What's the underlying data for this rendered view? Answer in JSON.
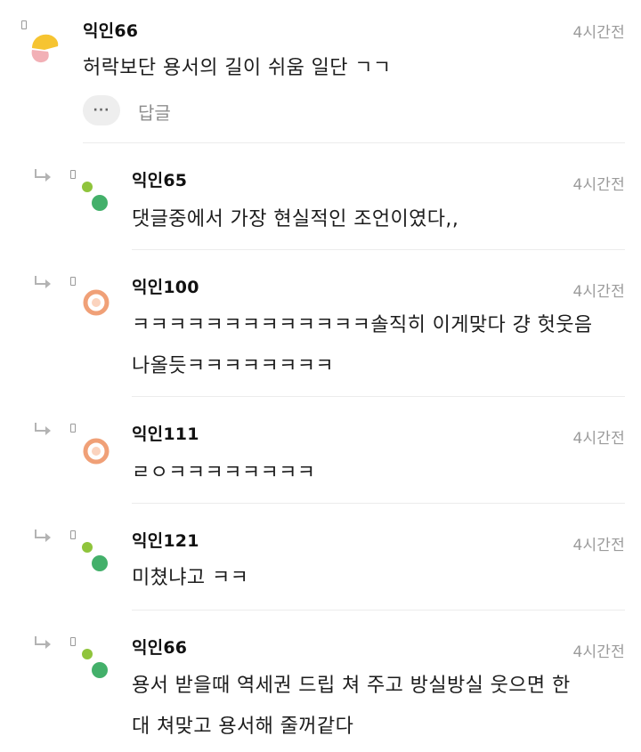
{
  "comments": [
    {
      "author": "익인66",
      "time": "4시간전",
      "text": "허락보단 용서의 길이 쉬움 일단 ㄱㄱ",
      "more_label": "···",
      "reply_label": "답글",
      "avatar_icon": "yellow-pink-blob-avatar-icon"
    },
    {
      "author": "익인65",
      "time": "4시간전",
      "text": "댓글중에서 가장 현실적인 조언이였다,,",
      "avatar_icon": "green-dots-avatar-icon"
    },
    {
      "author": "익인100",
      "time": "4시간전",
      "text_line1": "ㅋㅋㅋㅋㅋㅋㅋㅋㅋㅋㅋㅋㅋ솔직히 이게맞다 걍 헛웃음",
      "text_line2": "나올듯ㅋㅋㅋㅋㅋㅋㅋㅋ",
      "avatar_icon": "orange-ring-avatar-icon"
    },
    {
      "author": "익인111",
      "time": "4시간전",
      "text": "ㄹㅇㅋㅋㅋㅋㅋㅋㅋㅋ",
      "avatar_icon": "orange-ring-avatar-icon"
    },
    {
      "author": "익인121",
      "time": "4시간전",
      "text": "미쳤냐고 ㅋㅋ",
      "avatar_icon": "green-dots-avatar-icon"
    },
    {
      "author": "익인66",
      "time": "4시간전",
      "text_line1": "용서 받을때 역세권 드립 쳐 주고 방실방실 웃으면 한",
      "text_line2": "대 쳐맞고 용서해 줄꺼같다",
      "avatar_icon": "green-dots-avatar-icon"
    }
  ],
  "colors": {
    "green_large": "#43b06a",
    "green_small": "#8fc43c",
    "orange": "#f0a077",
    "yellow": "#f6c431",
    "pink": "#f2b0b6",
    "time_gray": "#9b9b9b"
  }
}
